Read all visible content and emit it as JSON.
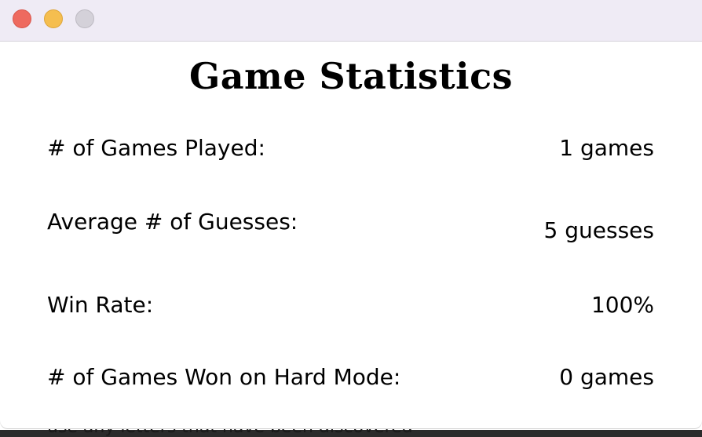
{
  "window": {
    "title": "Game Statistics",
    "controls": [
      "close",
      "minimize",
      "zoom"
    ]
  },
  "stats": [
    {
      "label": "# of Games Played:",
      "value": "1 games"
    },
    {
      "label": "Average # of Guesses:",
      "value": "5 guesses"
    },
    {
      "label": "Win Rate:",
      "value": "100%"
    },
    {
      "label": "# of Games Won on Hard Mode:",
      "value": "0 games"
    }
  ],
  "background_window": {
    "partial_text": "use any letters that have been discovered"
  },
  "colors": {
    "titlebar": "#efebf5",
    "close": "#ee6a5f",
    "minimize": "#f5be4f",
    "zoom": "#d4d1d9"
  }
}
